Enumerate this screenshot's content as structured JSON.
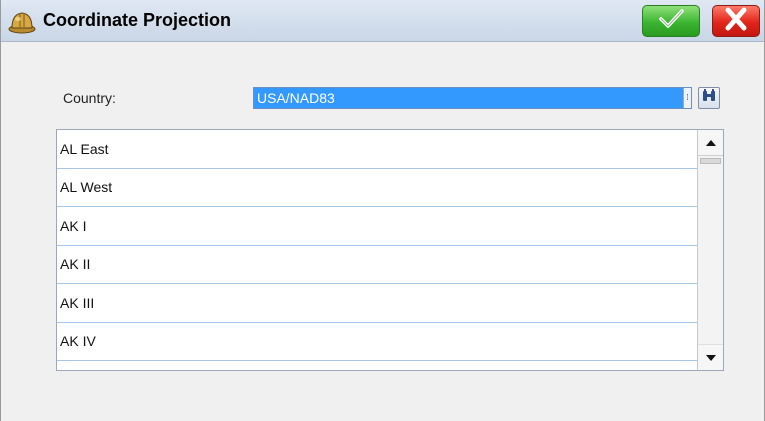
{
  "window": {
    "title": "Coordinate Projection",
    "icons": {
      "app": "hard-hat-icon",
      "ok": "checkmark-icon",
      "cancel": "close-x-icon"
    },
    "colors": {
      "ok": "#3cb531",
      "cancel": "#e0251a",
      "selection": "#3399ff"
    }
  },
  "form": {
    "country_label": "Country:",
    "country_value": "USA/NAD83",
    "search_icon": "binoculars-icon"
  },
  "list": {
    "items": [
      "AL East",
      "AL West",
      "AK I",
      "AK II",
      "AK III",
      "AK IV"
    ],
    "scroll_icons": {
      "up": "triangle-up-icon",
      "down": "triangle-down-icon"
    }
  }
}
